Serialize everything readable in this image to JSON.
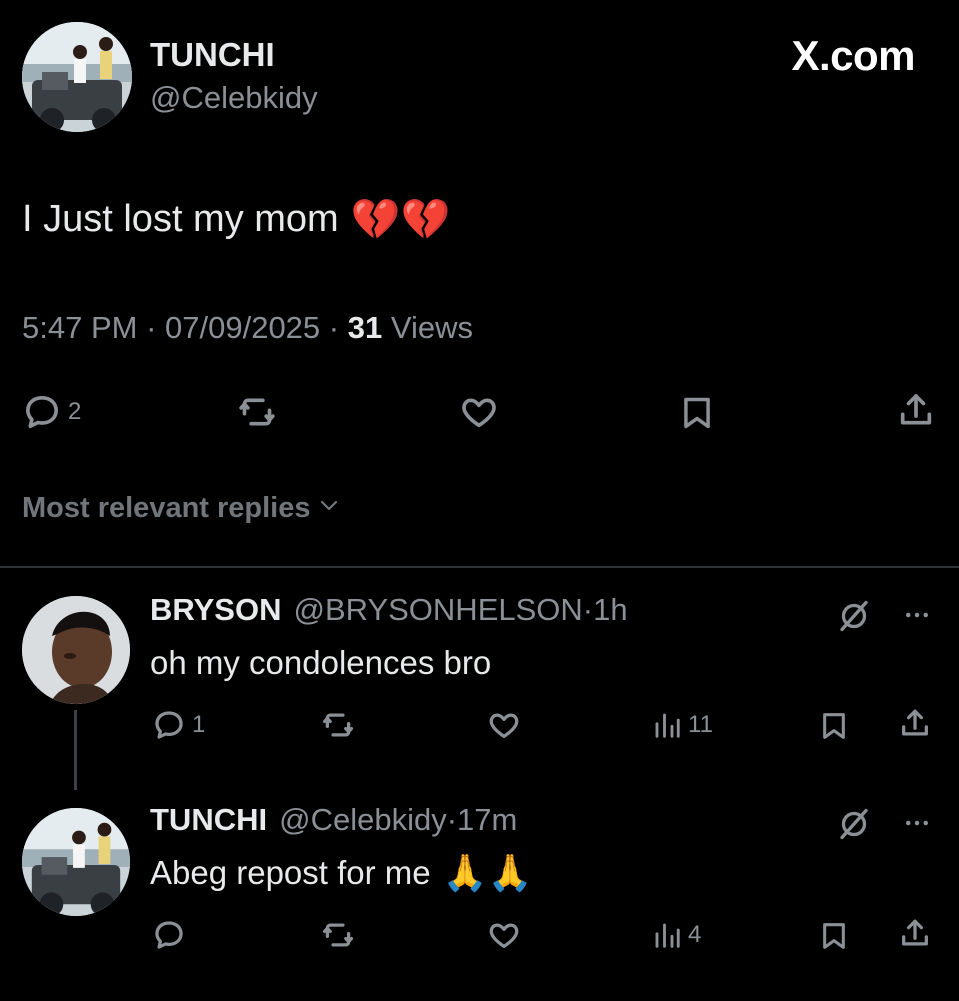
{
  "watermark": "X.com",
  "tweet": {
    "author_name": "TUNCHI",
    "author_handle": "@Celebkidy",
    "text": "I Just lost my mom",
    "emoji": "💔💔",
    "time": "5:47 PM",
    "sep1": " · ",
    "date": "07/09/2025",
    "sep2": " · ",
    "views_count": "31",
    "views_label": " Views",
    "actions": {
      "reply_count": "2",
      "retweet_icon": "retweet-icon",
      "like_icon": "heart-icon",
      "bookmark_icon": "bookmark-icon",
      "share_icon": "share-icon"
    }
  },
  "replies_sort": {
    "label": "Most relevant replies"
  },
  "replies": [
    {
      "name": "BRYSON",
      "handle": "@BRYSONHELSON",
      "sep": " · ",
      "time": "1h",
      "text": "oh my condolences bro",
      "emoji": "",
      "reply_count": "1",
      "views_count": "11"
    },
    {
      "name": "TUNCHI",
      "handle": "@Celebkidy",
      "sep": " · ",
      "time": "17m",
      "text": "Abeg repost for me",
      "emoji": "🙏🙏",
      "reply_count": "",
      "views_count": "4"
    }
  ],
  "colors": {
    "background": "#000000",
    "text_primary": "#e7e9ea",
    "text_secondary": "#8b9096",
    "divider": "#2f3336"
  }
}
